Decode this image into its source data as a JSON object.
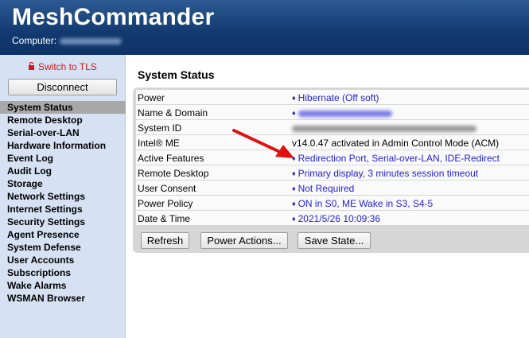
{
  "header": {
    "title": "MeshCommander",
    "computer_label": "Computer:"
  },
  "sidebar": {
    "tls_link": "Switch to TLS",
    "disconnect": "Disconnect",
    "items": [
      {
        "label": "System Status",
        "active": true
      },
      {
        "label": "Remote Desktop"
      },
      {
        "label": "Serial-over-LAN"
      },
      {
        "label": "Hardware Information"
      },
      {
        "label": "Event Log"
      },
      {
        "label": "Audit Log"
      },
      {
        "label": "Storage"
      },
      {
        "label": "Network Settings"
      },
      {
        "label": "Internet Settings"
      },
      {
        "label": "Security Settings"
      },
      {
        "label": "Agent Presence"
      },
      {
        "label": "System Defense"
      },
      {
        "label": "User Accounts"
      },
      {
        "label": "Subscriptions"
      },
      {
        "label": "Wake Alarms"
      },
      {
        "label": "WSMAN Browser"
      }
    ]
  },
  "main": {
    "title": "System Status",
    "rows": [
      {
        "label": "Power",
        "value": "Hibernate (Off soft)",
        "link": true
      },
      {
        "label": "Name & Domain",
        "value": "",
        "link": true,
        "redacted": true
      },
      {
        "label": "System ID",
        "value": "",
        "link": false,
        "redacted": true
      },
      {
        "label": "Intel® ME",
        "value": "v14.0.47 activated in Admin Control Mode (ACM)",
        "link": false
      },
      {
        "label": "Active Features",
        "value": "Redirection Port, Serial-over-LAN, IDE-Redirect",
        "link": true
      },
      {
        "label": "Remote Desktop",
        "value": "Primary display, 3 minutes session timeout",
        "link": true
      },
      {
        "label": "User Consent",
        "value": "Not Required",
        "link": true
      },
      {
        "label": "Power Policy",
        "value": "ON in S0, ME Wake in S3, S4-5",
        "link": true
      },
      {
        "label": "Date & Time",
        "value": "2021/5/26 10:09:36",
        "link": true
      }
    ],
    "buttons": {
      "refresh": "Refresh",
      "power_actions": "Power Actions...",
      "save_state": "Save State..."
    }
  },
  "colors": {
    "header_blue": "#123a70",
    "sidebar_bg": "#d6e2f4",
    "link_blue": "#2222d9",
    "tls_red": "#d21a1a",
    "arrow_red": "#e01010"
  },
  "icons": {
    "tls": "lock-icon",
    "row_marker": "diamond-icon",
    "annotation": "red-arrow-icon"
  }
}
